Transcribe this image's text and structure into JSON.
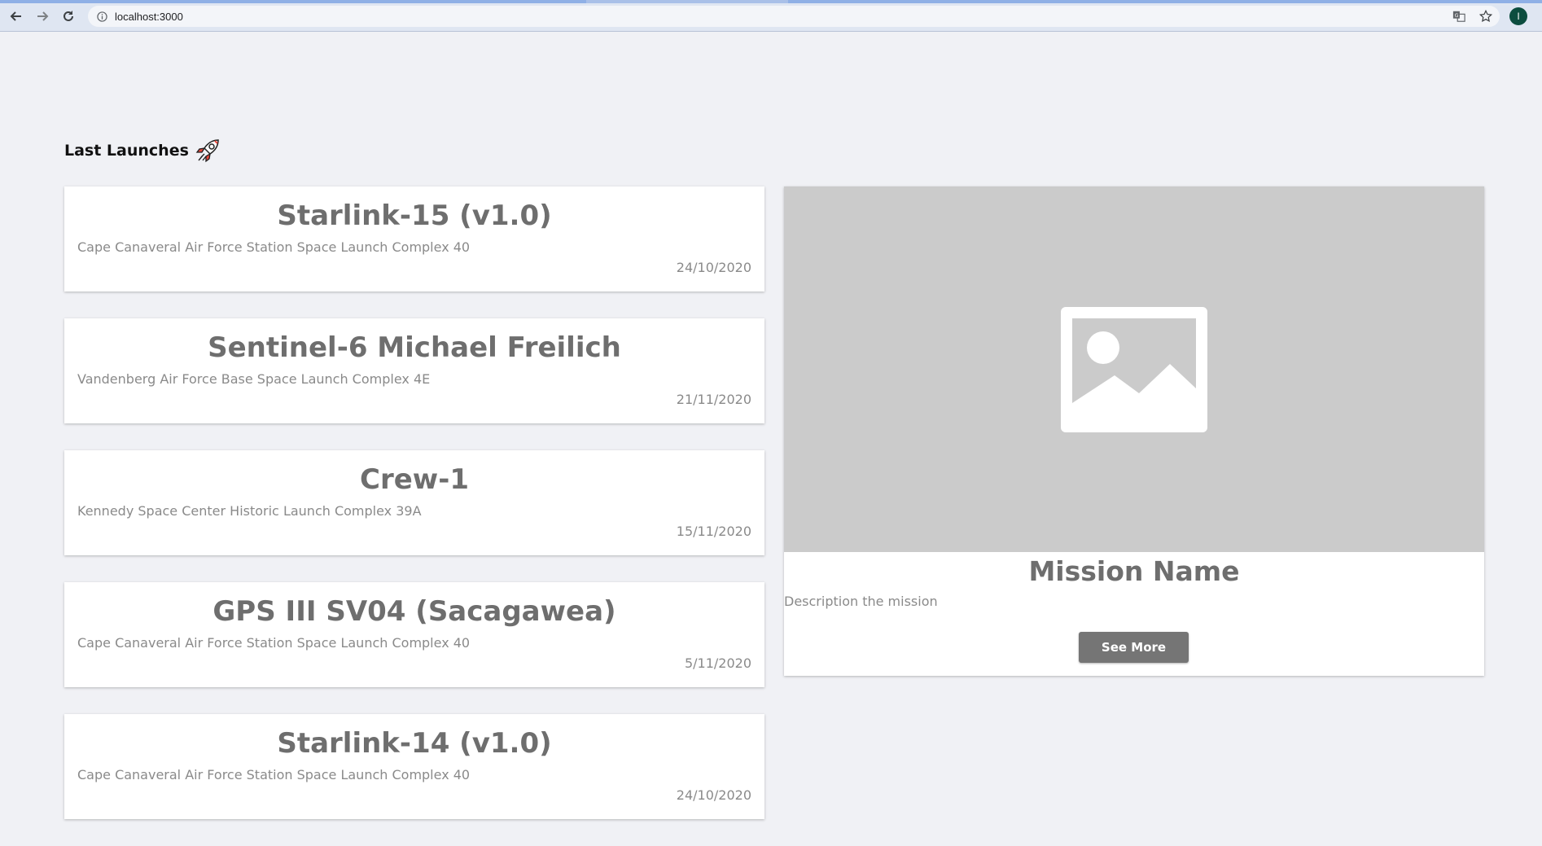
{
  "browser": {
    "url": "localhost:3000",
    "profile_initial": "I",
    "icons": {
      "back": "back-arrow-icon",
      "forward": "forward-arrow-icon",
      "reload": "reload-icon",
      "site_info": "info-icon",
      "translate": "translate-icon",
      "bookmark": "star-icon"
    }
  },
  "page": {
    "section_title": "Last Launches",
    "section_icon": "rocket-icon",
    "launches": [
      {
        "name": "Starlink-15 (v1.0)",
        "site": "Cape Canaveral Air Force Station Space Launch Complex 40",
        "date": "24/10/2020"
      },
      {
        "name": "Sentinel-6 Michael Freilich",
        "site": "Vandenberg Air Force Base Space Launch Complex 4E",
        "date": "21/11/2020"
      },
      {
        "name": "Crew-1",
        "site": "Kennedy Space Center Historic Launch Complex 39A",
        "date": "15/11/2020"
      },
      {
        "name": "GPS III SV04 (Sacagawea)",
        "site": "Cape Canaveral Air Force Station Space Launch Complex 40",
        "date": "5/11/2020"
      },
      {
        "name": "Starlink-14 (v1.0)",
        "site": "Cape Canaveral Air Force Station Space Launch Complex 40",
        "date": "24/10/2020"
      }
    ],
    "detail": {
      "image_icon": "image-placeholder-icon",
      "mission_name": "Mission Name",
      "description": "Description the mission",
      "button_label": "See More"
    }
  },
  "colors": {
    "page_background": "#f0f1f5",
    "card_background": "#ffffff",
    "title_text": "#6e6e6e",
    "secondary_text": "#8a8a8a",
    "button_background": "#757575",
    "image_placeholder": "#cbcbcb"
  }
}
